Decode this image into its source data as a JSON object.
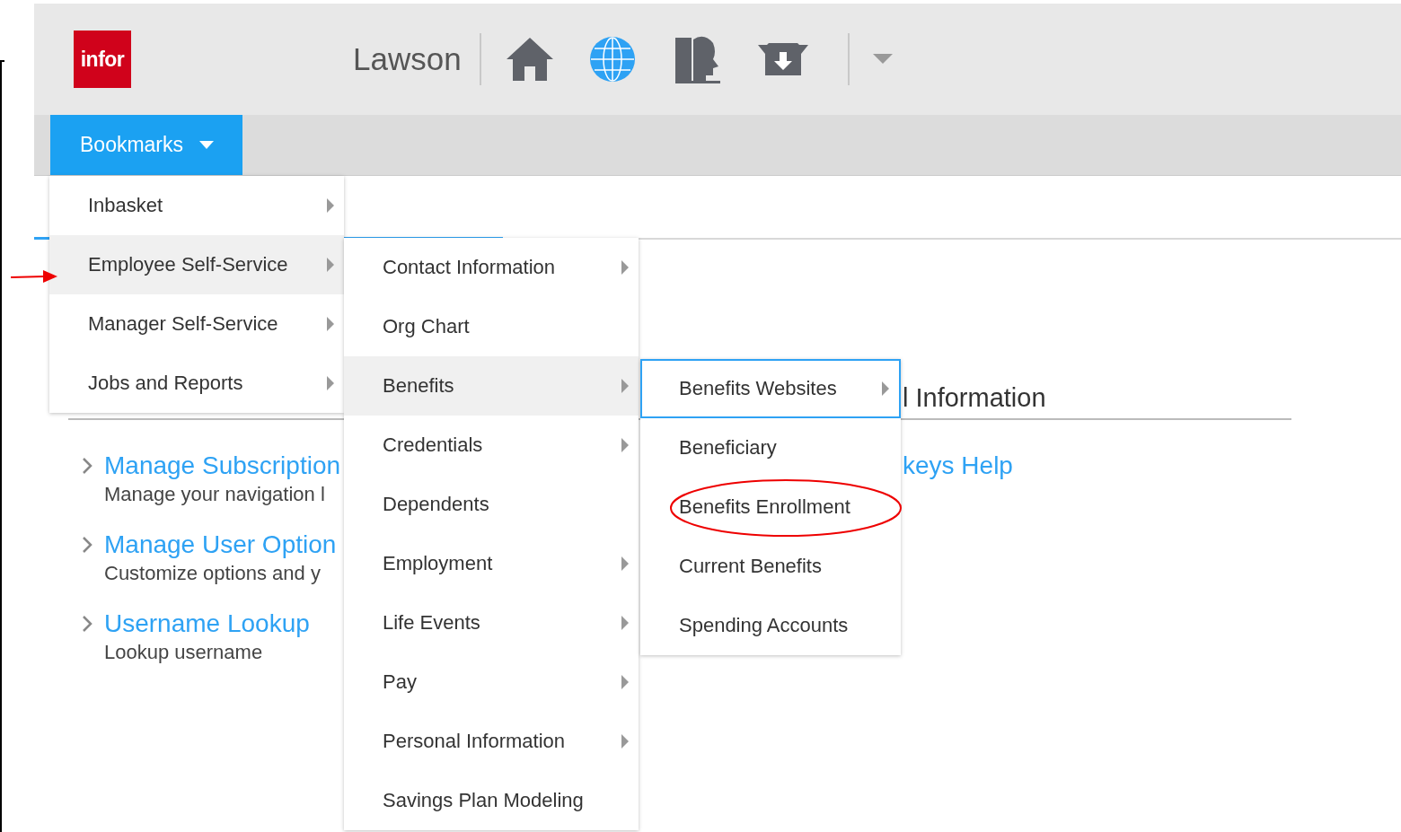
{
  "header": {
    "logo": "infor",
    "title": "Lawson"
  },
  "nav": {
    "bookmarks": "Bookmarks"
  },
  "page": {
    "heading": "l Information",
    "links": [
      {
        "title": "Manage Subscription",
        "description": "Manage your navigation l"
      },
      {
        "title": "Manage User Option",
        "description": "Customize options and y"
      },
      {
        "title": "Username Lookup",
        "description": "Lookup username"
      }
    ],
    "side_link": "keys Help"
  },
  "menus": [
    {
      "items": [
        {
          "label": "Inbasket",
          "submenu": true,
          "selected": false,
          "focused": false
        },
        {
          "label": "Employee Self-Service",
          "submenu": true,
          "selected": true,
          "focused": false
        },
        {
          "label": "Manager Self-Service",
          "submenu": true,
          "selected": false,
          "focused": false
        },
        {
          "label": "Jobs and Reports",
          "submenu": true,
          "selected": false,
          "focused": false
        }
      ]
    },
    {
      "items": [
        {
          "label": "Contact Information",
          "submenu": true,
          "selected": false,
          "focused": false
        },
        {
          "label": "Org Chart",
          "submenu": false,
          "selected": false,
          "focused": false
        },
        {
          "label": "Benefits",
          "submenu": true,
          "selected": true,
          "focused": false
        },
        {
          "label": "Credentials",
          "submenu": true,
          "selected": false,
          "focused": false
        },
        {
          "label": "Dependents",
          "submenu": false,
          "selected": false,
          "focused": false
        },
        {
          "label": "Employment",
          "submenu": true,
          "selected": false,
          "focused": false
        },
        {
          "label": "Life Events",
          "submenu": true,
          "selected": false,
          "focused": false
        },
        {
          "label": "Pay",
          "submenu": true,
          "selected": false,
          "focused": false
        },
        {
          "label": "Personal Information",
          "submenu": true,
          "selected": false,
          "focused": false
        },
        {
          "label": "Savings Plan Modeling",
          "submenu": false,
          "selected": false,
          "focused": false
        }
      ]
    },
    {
      "items": [
        {
          "label": "Benefits Websites",
          "submenu": true,
          "selected": false,
          "focused": true
        },
        {
          "label": "Beneficiary",
          "submenu": false,
          "selected": false,
          "focused": false
        },
        {
          "label": "Benefits Enrollment",
          "submenu": false,
          "selected": false,
          "focused": false
        },
        {
          "label": "Current Benefits",
          "submenu": false,
          "selected": false,
          "focused": false
        },
        {
          "label": "Spending Accounts",
          "submenu": false,
          "selected": false,
          "focused": false
        }
      ]
    }
  ]
}
